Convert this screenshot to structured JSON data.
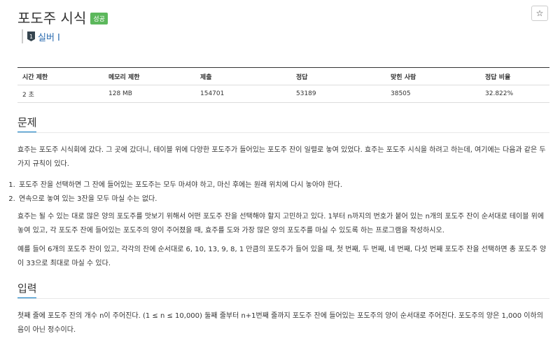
{
  "problem": {
    "title": "포도주 시식",
    "badge": "성공",
    "star_label": "☆",
    "tier": {
      "icon_text": "1",
      "label": "실버 I"
    }
  },
  "stats": {
    "headers": [
      "시간 제한",
      "메모리 제한",
      "제출",
      "정답",
      "맞힌 사람",
      "정답 비율"
    ],
    "values": [
      "2 초",
      "128 MB",
      "154701",
      "53189",
      "38505",
      "32.822%"
    ]
  },
  "sections": {
    "problem_title": "문제",
    "problem_intro": "효주는 포도주 시식회에 갔다. 그 곳에 갔더니, 테이블 위에 다양한 포도주가 들어있는 포도주 잔이 일렬로 놓여 있었다. 효주는 포도주 시식을 하려고 하는데, 여기에는 다음과 같은 두 가지 규칙이 있다.",
    "rules": [
      "포도주 잔을 선택하면 그 잔에 들어있는 포도주는 모두 마셔야 하고, 마신 후에는 원래 위치에 다시 놓아야 한다.",
      "연속으로 놓여 있는 3잔을 모두 마실 수는 없다."
    ],
    "problem_body": "효주는 될 수 있는 대로 많은 양의 포도주를 맛보기 위해서 어떤 포도주 잔을 선택해야 할지 고민하고 있다. 1부터 n까지의 번호가 붙어 있는 n개의 포도주 잔이 순서대로 테이블 위에 놓여 있고, 각 포도주 잔에 들어있는 포도주의 양이 주어졌을 때, 효주를 도와 가장 많은 양의 포도주를 마실 수 있도록 하는 프로그램을 작성하시오.",
    "problem_example": "예를 들어 6개의 포도주 잔이 있고, 각각의 잔에 순서대로 6, 10, 13, 9, 8, 1 만큼의 포도주가 들어 있을 때, 첫 번째, 두 번째, 네 번째, 다섯 번째 포도주 잔을 선택하면 총 포도주 양이 33으로 최대로 마실 수 있다.",
    "input_title": "입력",
    "input_body": "첫째 줄에 포도주 잔의 개수 n이 주어진다. (1 ≤ n ≤ 10,000) 둘째 줄부터 n+1번째 줄까지 포도주 잔에 들어있는 포도주의 양이 순서대로 주어진다. 포도주의 양은 1,000 이하의 음이 아닌 정수이다."
  },
  "colors": {
    "accent": "#0076c0",
    "badge": "#5cb85c",
    "tier_link": "#2b6cb0"
  }
}
